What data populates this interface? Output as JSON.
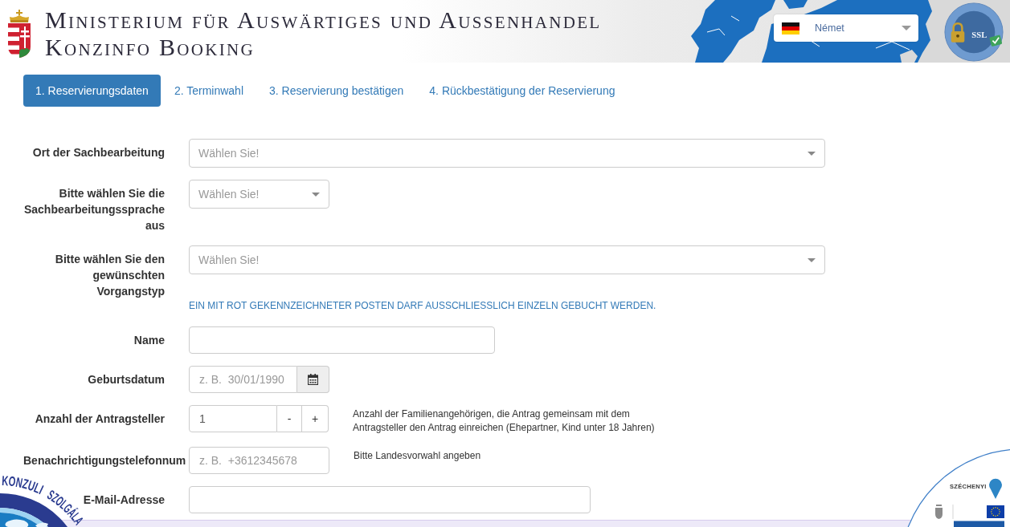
{
  "header": {
    "title_lines": [
      "Ministerium für Auswärtiges und Aussenhandel",
      "Konzinfo Booking"
    ],
    "language_select": {
      "value": "Német"
    },
    "ssl_seal": {
      "text": "SSL"
    }
  },
  "steps": [
    {
      "label": "1. Reservierungsdaten",
      "selected": true
    },
    {
      "label": "2. Terminwahl",
      "selected": false
    },
    {
      "label": "3. Reservierung bestätigen",
      "selected": false
    },
    {
      "label": "4. Rückbestätigung der Reservierung",
      "selected": false
    }
  ],
  "form": {
    "rows": [
      {
        "kind": "select",
        "label": "Ort der Sachbearbeitung",
        "placeholder": "Wählen Sie!"
      },
      {
        "kind": "select",
        "label": "Bitte wählen Sie die Sachbearbeitungssprache aus",
        "placeholder": "Wählen Sie!"
      },
      {
        "kind": "select",
        "label": "Bitte wählen Sie den gewünschten Vorgangstyp",
        "placeholder": "Wählen Sie!",
        "note": "EIN MIT ROT GEKENNZEICHNETER POSTEN DARF AUSSCHLIESSLICH EINZELN GEBUCHT WERDEN."
      },
      {
        "kind": "input",
        "label": "Name"
      },
      {
        "kind": "date",
        "label": "Geburtsdatum",
        "placeholder": "z. B.  30/01/1990"
      },
      {
        "kind": "stepper",
        "label": "Anzahl der Antragsteller",
        "value": "1",
        "decrement": "-",
        "increment": "+",
        "help": "Anzahl der Familienangehörigen, die Antrag gemeinsam mit dem Antragsteller den Antrag einreichen (Ehepartner, Kind unter 18 Jahren)"
      },
      {
        "kind": "input",
        "label": "Benachrichtigungstelefonnum",
        "placeholder": "z. B.  +3612345678",
        "help": "Bitte Landesvorwahl angeben"
      },
      {
        "kind": "input",
        "label": "E-Mail-Adresse"
      }
    ]
  },
  "logos": {
    "konzuli_words": [
      "KONZULI",
      "SZOLGÁLA"
    ],
    "szechenyi": {
      "title": "SZÉCHENYI"
    }
  }
}
